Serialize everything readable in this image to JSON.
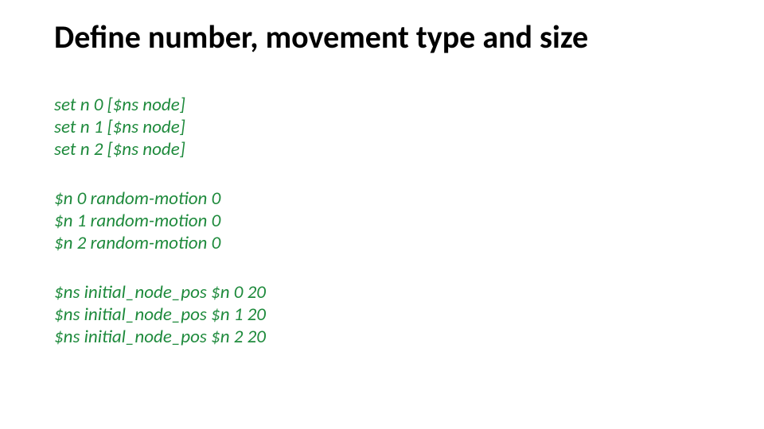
{
  "title": "Define number, movement type and size",
  "groups": [
    {
      "lines": [
        "set n 0 [$ns node]",
        "set n 1 [$ns node]",
        "set n 2 [$ns node]"
      ]
    },
    {
      "lines": [
        "$n 0 random-motion 0",
        "$n 1 random-motion 0",
        "$n 2 random-motion 0"
      ]
    },
    {
      "lines": [
        "$ns initial_node_pos $n 0 20",
        "$ns initial_node_pos $n 1 20",
        "$ns initial_node_pos $n 2 20"
      ]
    }
  ]
}
